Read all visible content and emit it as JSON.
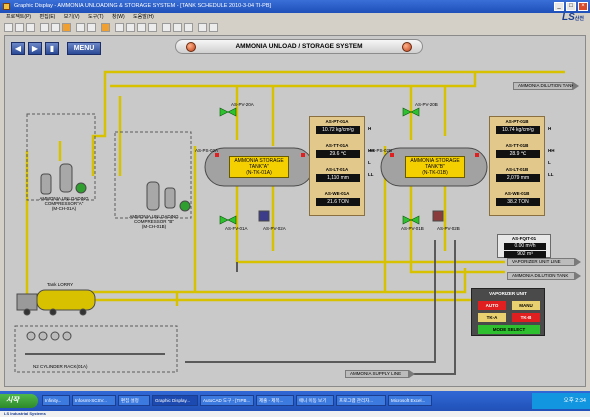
{
  "window": {
    "title": "Graphic Display - AMMONIA UNLOADING & STORAGE SYSTEM - [TANK SCHEDULE 2010-3-04 TI-PB]",
    "logo": "LS",
    "logo_sub": "산전"
  },
  "menubar": [
    "프로젝트(P)",
    "편집(E)",
    "보기(V)",
    "도구(T)",
    "창(W)",
    "도움말(H)"
  ],
  "hmi": {
    "title": "AMMONIA UNLOAD / STORAGE SYSTEM",
    "menu_label": "MENU",
    "tank_a": {
      "label": [
        "AMMONIA STORAGE",
        "TANK\"A\"",
        "(N-TK-01A)"
      ]
    },
    "tank_b": {
      "label": [
        "AMMONIA STORAGE",
        "TANK\"B\"",
        "(N-TK-01B)"
      ]
    },
    "panel_a": [
      {
        "tag": "AS-PT-01A",
        "value": "10.72 kg/cm²g"
      },
      {
        "tag": "AS-TT-01A",
        "value": "29.6 ℃"
      },
      {
        "tag": "AS-LT-01A",
        "value": "1,110 mm"
      },
      {
        "tag": "AS-WE-01A",
        "value": "21.6 TON"
      }
    ],
    "panel_b": [
      {
        "tag": "AS-PT-01B",
        "value": "10.74 kg/cm²g"
      },
      {
        "tag": "AS-TT-01B",
        "value": "28.9 ℃"
      },
      {
        "tag": "AS-LT-01B",
        "value": "2,079 mm"
      },
      {
        "tag": "AS-WE-01B",
        "value": "38.2 TON"
      }
    ],
    "valve_tags": {
      "pv20a": "AS-PV-20A",
      "pv01a": "AS-FV-01A",
      "pv02a": "AS-PV-02A",
      "pv20b": "AS-PV-20B",
      "pv01b": "AS-PV-01B",
      "pv02b": "AS-PV-02B",
      "ps02a": "AS-PS-02A",
      "ps02b": "AS-PS-02B"
    },
    "compressor_a": [
      "AMMONIA UNLOADING",
      "COMPRESSOR\"A\"",
      "(M-CH-01A)"
    ],
    "compressor_b": [
      "AMMONIA UNLOADING",
      "COMPRESSOR \"B\"",
      "(M-CH-01B)"
    ],
    "lorry_label": "Tank LORRY",
    "cylinder_label": "N2 CYLINDER RACK(01A)",
    "arrows": {
      "dilution_top": "AMMONIA DILUTION TANK",
      "vaporizer": "VAPORIZER UNIT LINE",
      "dilution_bottom": "AMMONIA DILUTION TANK",
      "supply": "AMMONIA SUPPLY LINE"
    },
    "flow": {
      "tag": "AS-FQIT-01",
      "rate": "0.00 m³/h",
      "total": "902 m³"
    },
    "vaporizer": {
      "title": "VAPORIZER UNIT",
      "auto": "AUTO",
      "manu": "MANU",
      "tka": "TK-A",
      "tkb": "TK-B",
      "mode": "MODE SELECT"
    },
    "hh_labels": [
      "H",
      "HH",
      "L",
      "LL"
    ]
  },
  "taskbar": {
    "start": "시작",
    "tasks": [
      "Infinity...",
      "Infosmt-SCSV...",
      "편집 설정",
      "Graphic Display...",
      "AutoCAD 도구 - [TIPB...",
      "제출 - 제목...",
      "애니 이동 보기",
      "프로그램 관리자...",
      "Microsoft Excel..."
    ],
    "clock": "오후 2:34",
    "brand": "LS Industrial Systems"
  },
  "colors": {
    "pipe": "#d8c200",
    "tank": "#9a9a9a",
    "accent": "#2a4a96",
    "panel": "#e2c88a"
  }
}
